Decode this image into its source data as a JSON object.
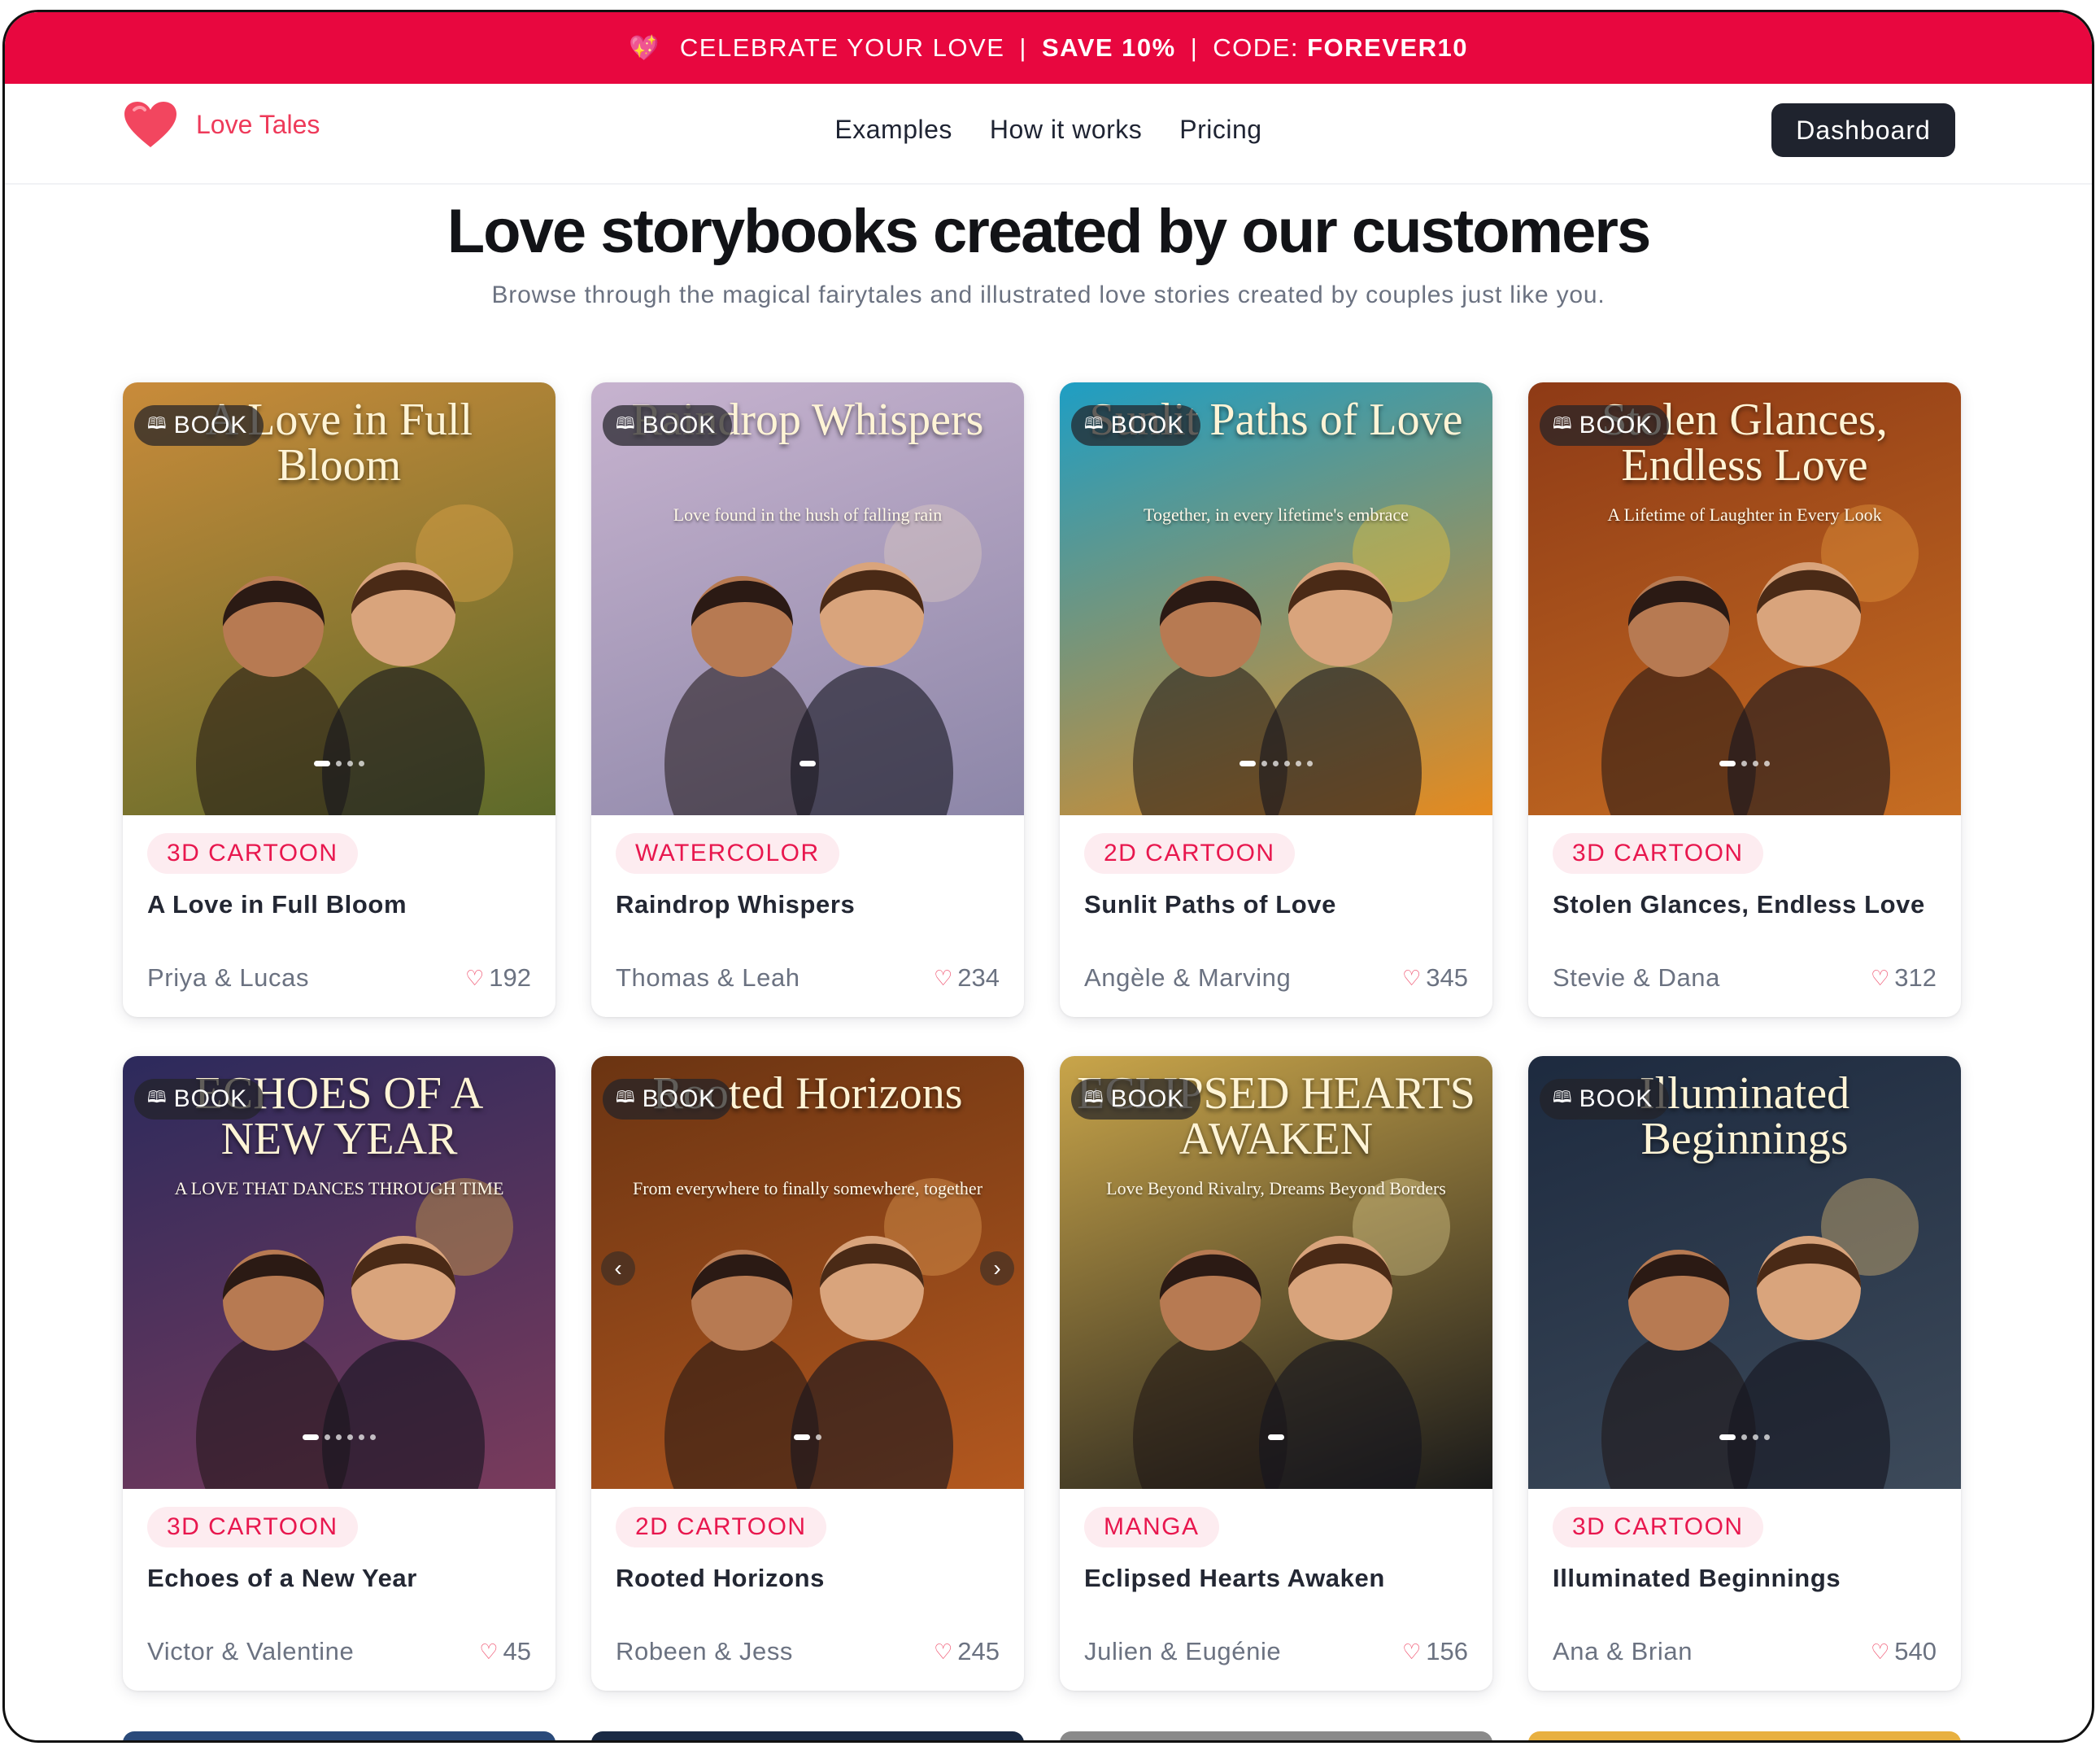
{
  "promo": {
    "emoji": "💖",
    "text": "CELEBRATE YOUR LOVE",
    "sep": "|",
    "save": "SAVE 10%",
    "code_label": "CODE:",
    "code": "FOREVER10"
  },
  "nav": {
    "brand": "Love Tales",
    "links": [
      "Examples",
      "How it works",
      "Pricing"
    ],
    "dashboard": "Dashboard"
  },
  "hero": {
    "title": "Love storybooks created by our customers",
    "subtitle": "Browse through the magical fairytales and illustrated love stories created by couples just like you."
  },
  "badge_label": "BOOK",
  "cards": [
    {
      "style": "3D CARTOON",
      "title": "A Love in Full Bloom",
      "couple": "Priya & Lucas",
      "likes": "192",
      "cover_title": "A Love in Full Bloom",
      "cover_sub": "",
      "bg": [
        "#c98b3a",
        "#5d6a2a"
      ],
      "accent": "#f2b04d"
    },
    {
      "style": "WATERCOLOR",
      "title": "Raindrop Whispers",
      "couple": "Thomas & Leah",
      "likes": "234",
      "cover_title": "Raindrop Whispers",
      "cover_sub": "Love found in the hush of falling rain",
      "bg": [
        "#c7b3cf",
        "#8c86a8"
      ],
      "accent": "#e9d5c4"
    },
    {
      "style": "2D CARTOON",
      "title": "Sunlit Paths of Love",
      "couple": "Angèle & Marving",
      "likes": "345",
      "cover_title": "Sunlit Paths of Love",
      "cover_sub": "Together, in every lifetime's embrace",
      "bg": [
        "#1e9ec4",
        "#e58a1f"
      ],
      "accent": "#ffcf2f"
    },
    {
      "style": "3D CARTOON",
      "title": "Stolen Glances, Endless Love",
      "couple": "Stevie & Dana",
      "likes": "312",
      "cover_title": "Stolen Glances, Endless Love",
      "cover_sub": "A Lifetime of Laughter in Every Look",
      "bg": [
        "#8e3a16",
        "#c66d22"
      ],
      "accent": "#f1a646"
    },
    {
      "style": "3D CARTOON",
      "title": "Echoes of a New Year",
      "couple": "Victor & Valentine",
      "likes": "45",
      "cover_title": "ECHOES OF A NEW YEAR",
      "cover_sub": "A LOVE THAT DANCES THROUGH TIME",
      "bg": [
        "#2c2a5c",
        "#7a3b5c"
      ],
      "accent": "#f0c040"
    },
    {
      "style": "2D CARTOON",
      "title": "Rooted Horizons",
      "couple": "Robeen & Jess",
      "likes": "245",
      "cover_title": "Rooted Horizons",
      "cover_sub": "From everywhere to finally somewhere, together",
      "bg": [
        "#6b3412",
        "#b3581f"
      ],
      "accent": "#f0b060"
    },
    {
      "style": "MANGA",
      "title": "Eclipsed Hearts Awaken",
      "couple": "Julien & Eugénie",
      "likes": "156",
      "cover_title": "ECLIPSED HEARTS AWAKEN",
      "cover_sub": "Love Beyond Rivalry, Dreams Beyond Borders",
      "bg": [
        "#c9a54a",
        "#1a1a1a"
      ],
      "accent": "#f4e3a1"
    },
    {
      "style": "3D CARTOON",
      "title": "Illuminated Beginnings",
      "couple": "Ana & Brian",
      "likes": "540",
      "cover_title": "Illuminated Beginnings",
      "cover_sub": "",
      "bg": [
        "#1d2a3f",
        "#3d4a5a"
      ],
      "accent": "#ffd27a"
    }
  ],
  "peek_colors": [
    "#2a4a7a",
    "#1a2a44",
    "#8a8a8a",
    "#e8b040"
  ]
}
